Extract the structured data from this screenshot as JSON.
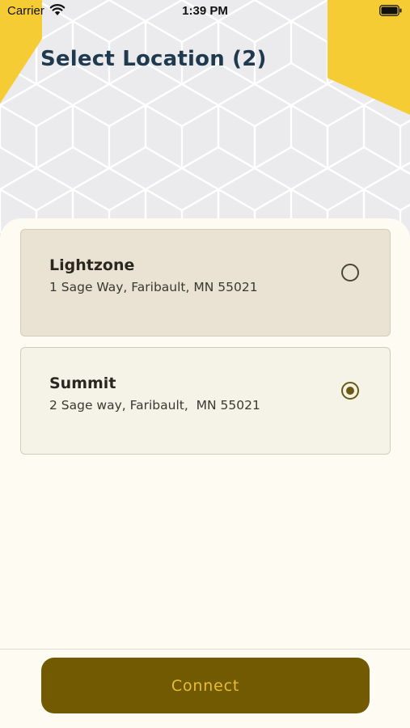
{
  "status_bar": {
    "carrier": "Carrier",
    "time": "1:39 PM",
    "wifi_icon": "wifi-icon",
    "battery_icon": "battery-full-icon"
  },
  "header": {
    "title": "Select Location (2)",
    "accent_color": "#f6cc35",
    "title_color": "#1f3a4e"
  },
  "locations": [
    {
      "name": "Lightzone",
      "address": "1 Sage Way, Faribault, MN 55021",
      "selected": false
    },
    {
      "name": "Summit",
      "address": "2 Sage way, Faribault,  MN 55021",
      "selected": true
    }
  ],
  "footer": {
    "connect_label": "Connect",
    "button_color": "#715a02",
    "button_text_color": "#e7bf2c"
  }
}
